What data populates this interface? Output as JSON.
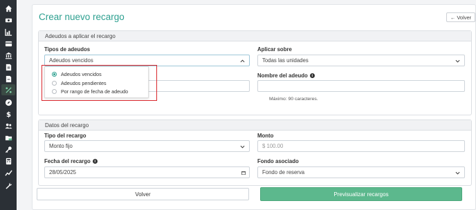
{
  "page_title": "Crear nuevo recargo",
  "back_label": "Volver",
  "section1": {
    "header": "Adeudos a aplicar el recargo",
    "tipos_label": "Tipos de adeudos",
    "tipos_value": "Adeudos vencidos",
    "aplicar_label": "Aplicar sobre",
    "aplicar_value": "Todas las unidades",
    "nombre_label": "Nombre del adeudo",
    "nombre_value": "",
    "nombre_hint": "Máximo: 90 caracteres."
  },
  "dropdown_options": [
    {
      "label": "Adeudos vencidos",
      "selected": true
    },
    {
      "label": "Adeudos pendientes",
      "selected": false
    },
    {
      "label": "Por rango de fecha de adeudo",
      "selected": false
    }
  ],
  "section2": {
    "header": "Datos del recargo",
    "tipo_label": "Tipo del recargo",
    "tipo_value": "Monto fijo",
    "monto_label": "Monto",
    "monto_placeholder": "$ 100.00",
    "fecha_label": "Fecha del recargo",
    "fecha_value": "28/05/2025",
    "fondo_label": "Fondo asociado",
    "fondo_value": "Fondo de reserva"
  },
  "buttons": {
    "volver": "Volver",
    "preview": "Previsualizar recargos"
  },
  "colors": {
    "accent": "#2c9f8f",
    "primary_button": "#5cb88d",
    "sidebar": "#2b3036",
    "highlight_box": "#d9262c"
  },
  "sidebar_icons": [
    "home-icon",
    "money-icon",
    "chart-icon",
    "card-icon",
    "bank-icon",
    "document-icon",
    "document-icon",
    "percent-icon",
    "compass-icon",
    "dollar-icon",
    "users-icon",
    "folder-icon",
    "key-icon",
    "calculator-icon",
    "report-icon",
    "wrench-icon"
  ]
}
